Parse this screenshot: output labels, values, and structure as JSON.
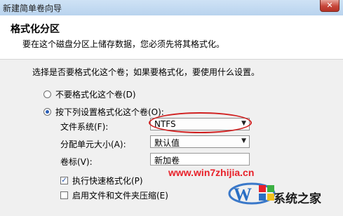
{
  "window": {
    "title": "新建简单卷向导",
    "close_label": "✕"
  },
  "header": {
    "title": "格式化分区",
    "subtitle": "要在这个磁盘分区上储存数据，您必须先将其格式化。"
  },
  "instruction": "选择是否要格式化这个卷；如果要格式化，要使用什么设置。",
  "options": {
    "no_format": {
      "label": "不要格式化这个卷(D)",
      "selected": false
    },
    "format": {
      "label": "按下列设置格式化这个卷(O):",
      "selected": true
    }
  },
  "fields": {
    "filesystem": {
      "label": "文件系统(F):",
      "value": "NTFS"
    },
    "allocation": {
      "label": "分配单元大小(A):",
      "value": "默认值"
    },
    "volume_label": {
      "label": "卷标(V):",
      "value": "新加卷"
    }
  },
  "checkboxes": {
    "quick_format": {
      "label": "执行快速格式化(P)",
      "checked": true
    },
    "compression": {
      "label": "启用文件和文件夹压缩(E)",
      "checked": false
    }
  },
  "watermark": {
    "url": "www.win7zhijia.cn",
    "logo_text": "系统之家"
  },
  "colors": {
    "accent": "#2a5db6",
    "highlight_circle": "#d02020",
    "watermark": "#e8212a"
  }
}
